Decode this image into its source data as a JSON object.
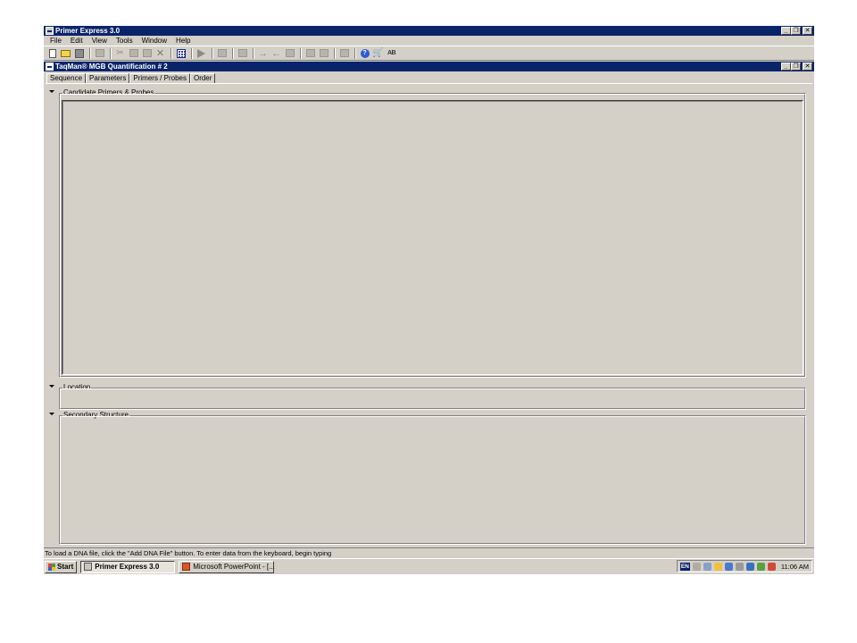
{
  "app": {
    "title": "Primer Express 3.0",
    "window_buttons": {
      "minimize": "_",
      "restore": "❐",
      "close": "✕"
    }
  },
  "menu": [
    "File",
    "Edit",
    "View",
    "Tools",
    "Window",
    "Help"
  ],
  "toolbar": {
    "icons": [
      "new-document-icon",
      "open-folder-icon",
      "save-icon",
      "print-icon",
      "cut-icon",
      "copy-icon",
      "paste-icon",
      "delete-icon",
      "grid-view-icon",
      "run-icon",
      "document-icon",
      "report-icon",
      "forward-arrow-icon",
      "back-arrow-icon",
      "list-icon",
      "export-icon",
      "stamp-icon",
      "table-icon",
      "help-icon",
      "shopping-cart-icon",
      "spell-check-icon"
    ],
    "spell_label": "AB"
  },
  "document": {
    "title": "TaqMan® MGB Quantification # 2",
    "tabs": [
      "Sequence",
      "Parameters",
      "Primers / Probes",
      "Order"
    ],
    "active_tab": "Primers / Probes"
  },
  "panels": {
    "candidates": "Candidate Primers & Probes",
    "location": "Location",
    "secondary": "Secondary Structure"
  },
  "status_bar": "To load a DNA file, click the \"Add DNA File\" button. To enter data from the keyboard, begin typing",
  "taskbar": {
    "start": "Start",
    "tasks": [
      "Primer Express 3.0",
      "Microsoft PowerPoint - [..."
    ],
    "language": "EN",
    "clock": "11:06 AM"
  },
  "colors": {
    "titlebar": "#0a246a",
    "face": "#d4d0c8"
  }
}
